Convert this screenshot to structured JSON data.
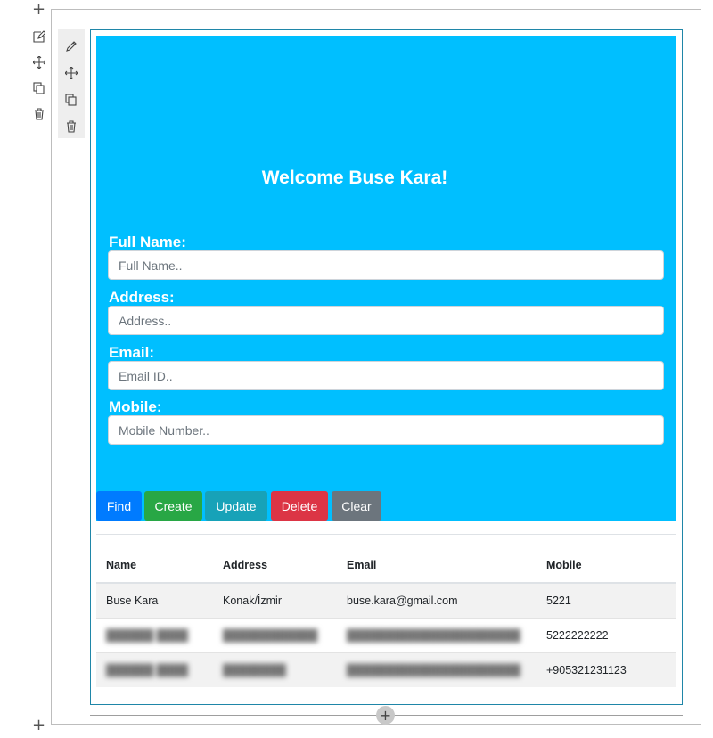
{
  "canvas": {
    "plus_top": "+",
    "plus_bottom": "+",
    "add_section": "+"
  },
  "toolbar_outer": [
    {
      "name": "edit-page-icon"
    },
    {
      "name": "move-icon"
    },
    {
      "name": "copy-icon"
    },
    {
      "name": "delete-icon"
    }
  ],
  "toolbar_inner": [
    {
      "name": "edit-pencil-icon"
    },
    {
      "name": "move-icon"
    },
    {
      "name": "copy-icon"
    },
    {
      "name": "delete-icon"
    }
  ],
  "hero": {
    "title": "Welcome Buse Kara!",
    "background": "#00bfff"
  },
  "form": {
    "full_name": {
      "label": "Full Name:",
      "placeholder": "Full Name..",
      "value": ""
    },
    "address": {
      "label": "Address:",
      "placeholder": "Address..",
      "value": ""
    },
    "email": {
      "label": "Email:",
      "placeholder": "Email ID..",
      "value": ""
    },
    "mobile": {
      "label": "Mobile:",
      "placeholder": "Mobile Number..",
      "value": ""
    }
  },
  "buttons": {
    "find": "Find",
    "create": "Create",
    "update": "Update",
    "delete": "Delete",
    "clear": "Clear"
  },
  "button_colors": {
    "find": "#007bff",
    "create": "#28a745",
    "update": "#17a2b8",
    "delete": "#dc3545",
    "clear": "#6c757d"
  },
  "table": {
    "headers": [
      "Name",
      "Address",
      "Email",
      "Mobile"
    ],
    "rows": [
      {
        "name": "Buse Kara",
        "address": "Konak/İzmir",
        "email": "buse.kara@gmail.com",
        "mobile": "5221"
      },
      {
        "name": "",
        "address": "",
        "email": "",
        "mobile": "5222222222"
      },
      {
        "name": "",
        "address": "",
        "email": "",
        "mobile": "+905321231123"
      }
    ]
  }
}
